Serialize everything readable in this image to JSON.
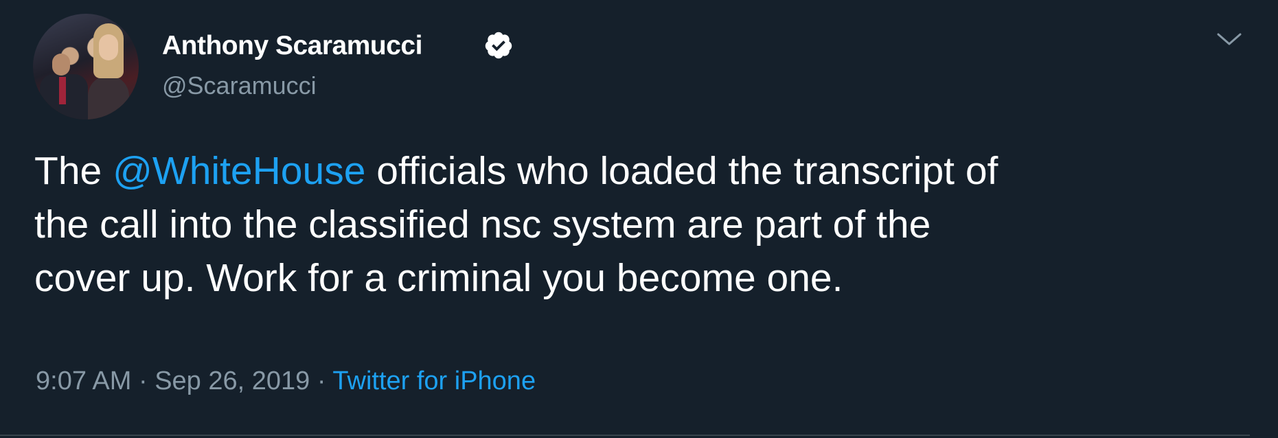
{
  "tweet": {
    "author": {
      "name": "Anthony Scaramucci",
      "handle": "@Scaramucci",
      "verified": true
    },
    "text": {
      "line1_before": "The ",
      "mention": "@WhiteHouse",
      "line1_after": " officials who loaded the transcript of",
      "line2": "the call into the classified nsc system are part of the",
      "line3": "cover up. Work for a criminal you become one."
    },
    "meta": {
      "time": "9:07 AM",
      "separator1": " · ",
      "date": "Sep 26, 2019",
      "separator2": " · ",
      "source": "Twitter for iPhone"
    }
  },
  "icons": {
    "verified": "verified-badge-icon",
    "menu": "chevron-down-icon"
  },
  "colors": {
    "background": "#15202b",
    "text": "#ffffff",
    "secondary": "#8899a6",
    "link": "#1da1f2"
  }
}
